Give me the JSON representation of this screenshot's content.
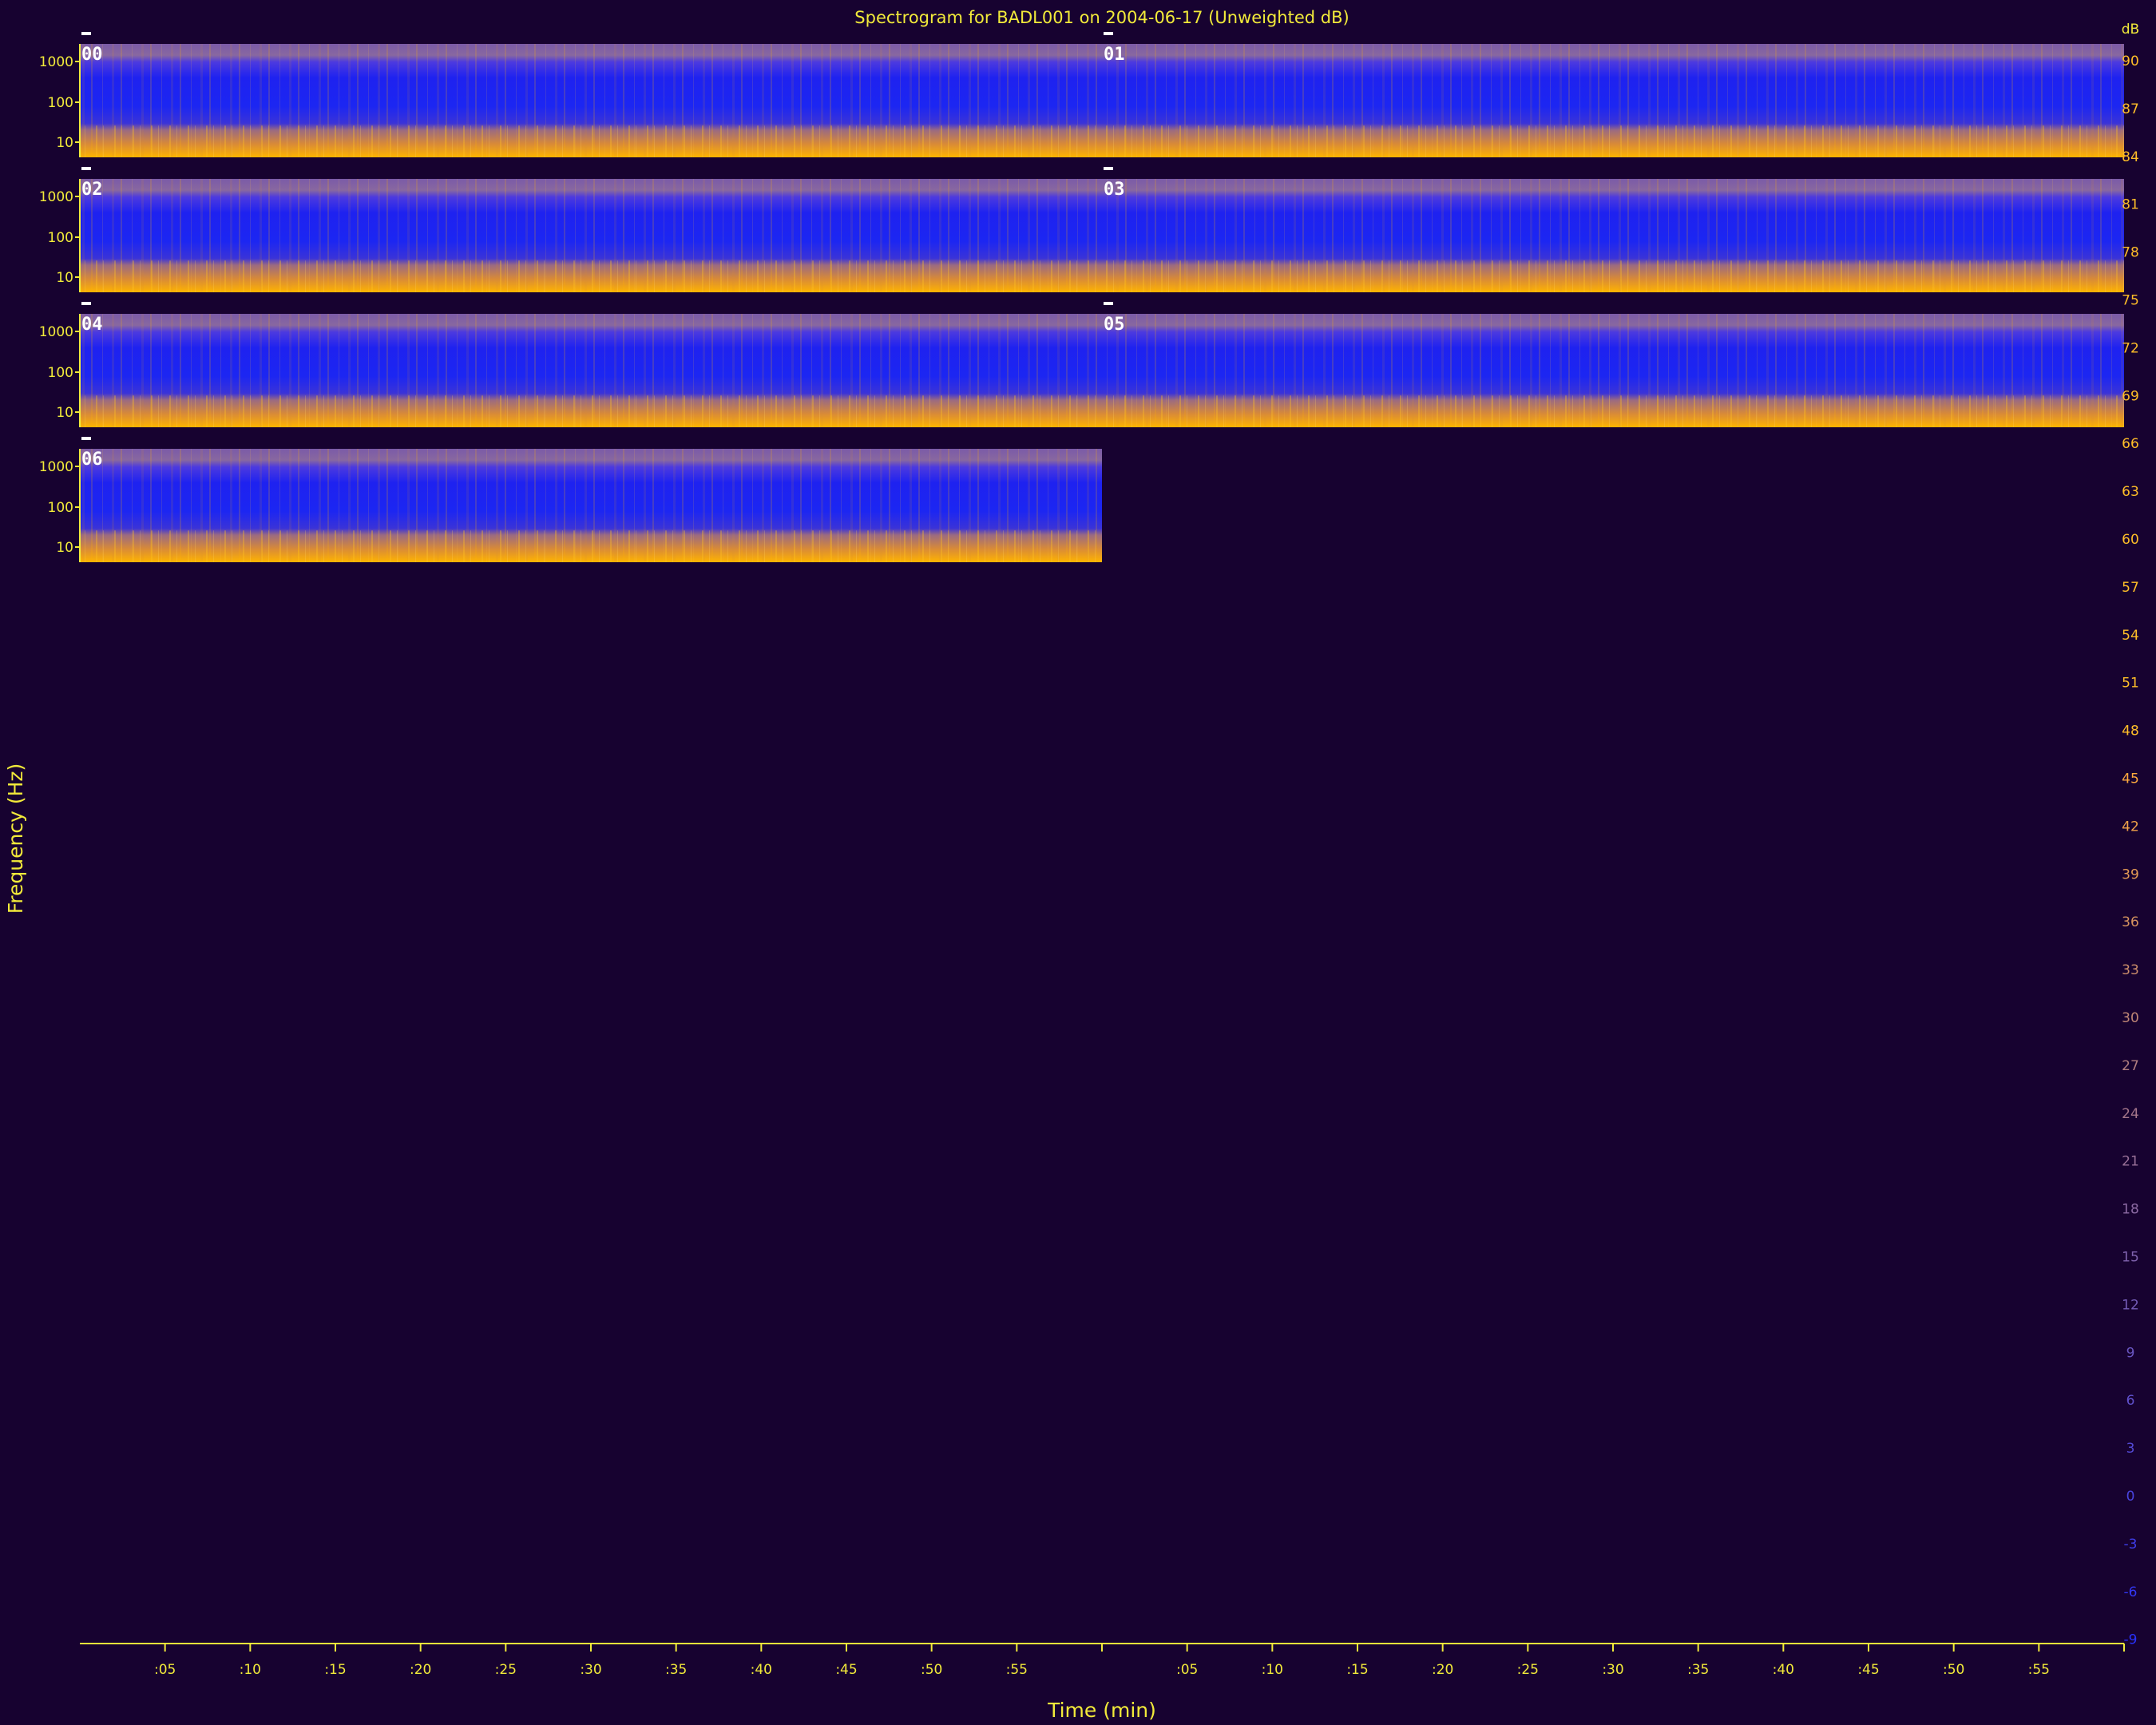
{
  "chart_data": {
    "type": "heatmap",
    "title": "Spectrogram for BADL001 on 2004-06-17 (Unweighted dB)",
    "xlabel": "Time (min)",
    "ylabel": "Frequency (Hz)",
    "x_tick_labels": [
      ":05",
      ":10",
      ":15",
      ":20",
      ":25",
      ":30",
      ":35",
      ":40",
      ":45",
      ":50",
      ":55"
    ],
    "y_tick_labels": [
      "1000",
      "100",
      "10"
    ],
    "hours_per_row": 2,
    "panels": [
      {
        "hour": "00"
      },
      {
        "hour": "01"
      },
      {
        "hour": "02"
      },
      {
        "hour": "03"
      },
      {
        "hour": "04"
      },
      {
        "hour": "05"
      },
      {
        "hour": "06"
      }
    ],
    "colorbar": {
      "unit": "dB",
      "min": -9,
      "max": 90,
      "step": 3,
      "labels": [
        "90",
        "87",
        "84",
        "81",
        "78",
        "75",
        "72",
        "69",
        "66",
        "63",
        "60",
        "57",
        "54",
        "51",
        "48",
        "45",
        "42",
        "39",
        "36",
        "33",
        "30",
        "27",
        "24",
        "21",
        "18",
        "15",
        "12",
        "9",
        "6",
        "3",
        "0",
        "-3",
        "-6",
        "-9"
      ],
      "colors": {
        "low": "#1a2cff",
        "mid": "#8a63a8",
        "high": "#ffb000"
      }
    },
    "grid": false
  }
}
